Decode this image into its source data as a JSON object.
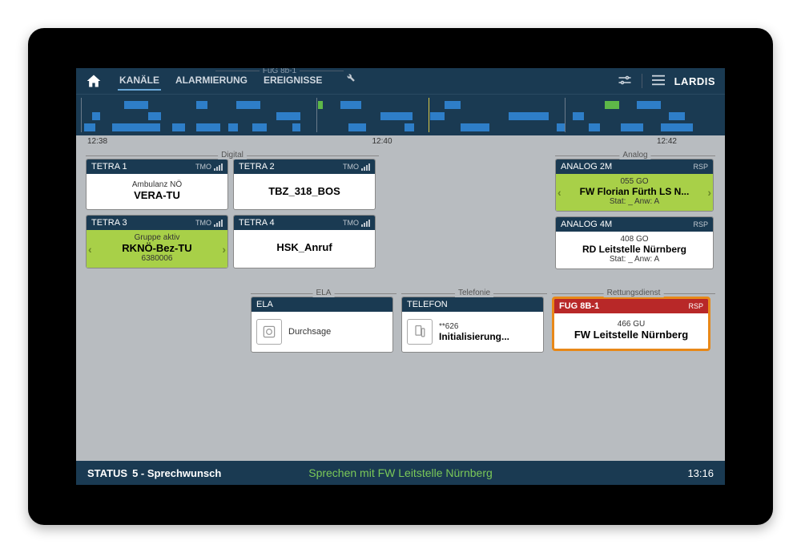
{
  "topbar": {
    "context_title": "FuG 8b-1",
    "tabs": [
      "KANÄLE",
      "ALARMIERUNG",
      "EREIGNISSE"
    ],
    "brand": "LARDIS"
  },
  "timeline": {
    "labels": [
      "12:38",
      "12:40",
      "12:42"
    ]
  },
  "groups": {
    "digital": "Digital",
    "analog": "Analog",
    "ela": "ELA",
    "telefonie": "Telefonie",
    "rettung": "Rettungsdienst"
  },
  "channels": {
    "tetra1": {
      "title": "TETRA 1",
      "mode": "TMO",
      "sub": "Ambulanz NÖ",
      "main": "VERA-TU"
    },
    "tetra2": {
      "title": "TETRA 2",
      "mode": "TMO",
      "sub": "",
      "main": "TBZ_318_BOS"
    },
    "tetra3": {
      "title": "TETRA 3",
      "mode": "TMO",
      "sub": "Gruppe aktiv",
      "main": "RKNÖ-Bez-TU",
      "extra": "6380006"
    },
    "tetra4": {
      "title": "TETRA 4",
      "mode": "TMO",
      "sub": "",
      "main": "HSK_Anruf"
    },
    "analog2m": {
      "title": "ANALOG 2M",
      "mode": "RSP",
      "sub": "055 GO",
      "main": "FW Florian Fürth LS N...",
      "extra": "Stat: _   Anw: A"
    },
    "analog4m": {
      "title": "ANALOG 4M",
      "mode": "RSP",
      "sub": "408 GO",
      "main": "RD Leitstelle Nürnberg",
      "extra": "Stat: _   Anw: A"
    },
    "ela": {
      "title": "ELA",
      "main": "Durchsage"
    },
    "telefon": {
      "title": "TELEFON",
      "sub": "**626",
      "main": "Initialisierung..."
    },
    "fug8b1": {
      "title": "FUG 8B-1",
      "mode": "RSP",
      "sub": "466 GU",
      "main": "FW Leitstelle Nürnberg"
    }
  },
  "bottombar": {
    "status_label": "STATUS",
    "status_value": "5 - Sprechwunsch",
    "center": "Sprechen mit FW Leitstelle Nürnberg",
    "time": "13:16"
  }
}
